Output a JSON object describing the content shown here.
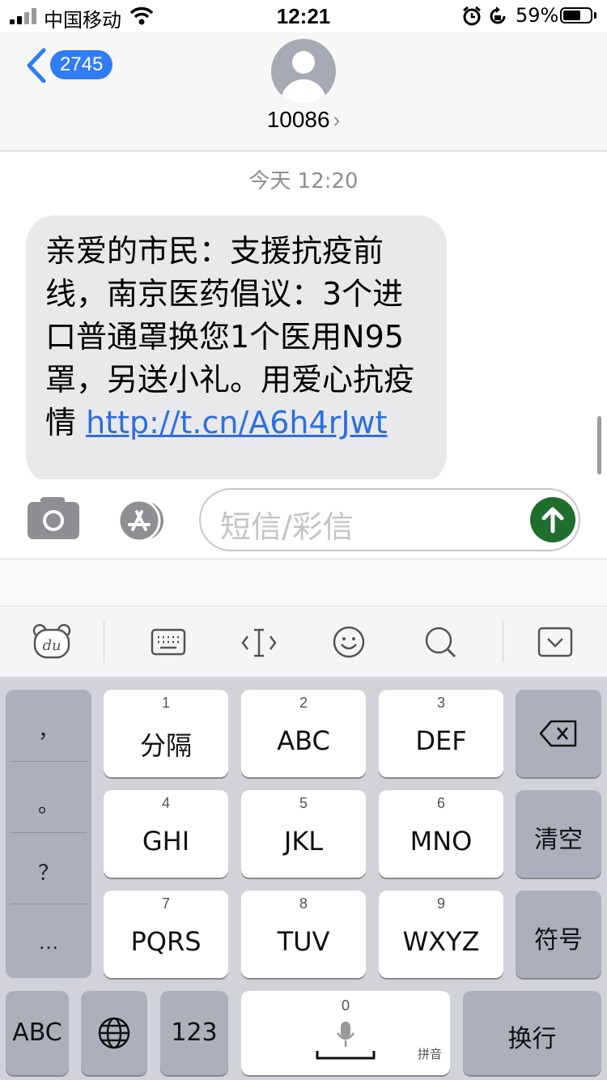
{
  "status": {
    "carrier": "中国移动",
    "time": "12:21",
    "battery_pct": "59%",
    "battery_level": 0.59
  },
  "nav": {
    "back_count": "2745",
    "contact": "10086",
    "chevron": "›"
  },
  "conversation": {
    "timestamp": "今天 12:20",
    "message_text": "亲爱的市民：支援抗疫前线，南京医药倡议：3个进口普通罩换您1个医用N95罩，另送小礼。用爱心抗疫情 ",
    "message_link": "http://t.cn/A6h4rJwt"
  },
  "compose": {
    "placeholder": "短信/彩信"
  },
  "toolbar": {
    "icons": [
      "du-bear-icon",
      "keyboard-icon",
      "cursor-icon",
      "emoji-icon",
      "search-icon",
      "collapse-keyboard-icon"
    ]
  },
  "keyboard": {
    "side_keys": [
      "，",
      "。",
      "？",
      "…"
    ],
    "keys": [
      {
        "num": "1",
        "label": "分隔"
      },
      {
        "num": "2",
        "label": "ABC"
      },
      {
        "num": "3",
        "label": "DEF"
      },
      {
        "num": "4",
        "label": "GHI"
      },
      {
        "num": "5",
        "label": "JKL"
      },
      {
        "num": "6",
        "label": "MNO"
      },
      {
        "num": "7",
        "label": "PQRS"
      },
      {
        "num": "8",
        "label": "TUV"
      },
      {
        "num": "9",
        "label": "WXYZ"
      }
    ],
    "clear": "清空",
    "symbols": "符号",
    "abc": "ABC",
    "num123": "123",
    "zero": "0",
    "pinyin": "拼音",
    "newline": "换行"
  },
  "colors": {
    "accent": "#2f7cf6",
    "send": "#1f6e2d",
    "bubble": "#e9e9eb",
    "link": "#2c6fe0"
  }
}
